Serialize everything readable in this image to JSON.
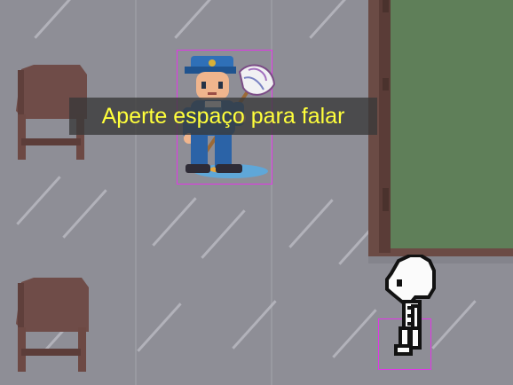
{
  "game": {
    "prompt_text": "Aperte espaço para falar"
  },
  "sprites": {
    "janitor": "janitor-npc-with-mop",
    "player": "skeleton-player",
    "chair_top": "wooden-chair",
    "chair_bottom": "wooden-chair",
    "board": "green-chalkboard"
  },
  "colors": {
    "floor": "#8e8e96",
    "board": "#5f7f59",
    "frame": "#6b4b45",
    "hitbox": "#e235e8",
    "prompt_text": "#ffff3b"
  }
}
